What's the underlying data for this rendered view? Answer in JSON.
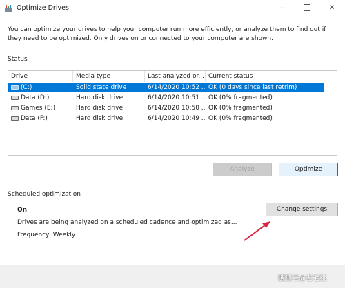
{
  "window": {
    "title": "Optimize Drives",
    "minimize_glyph": "—",
    "close_glyph": "✕"
  },
  "intro_text": "You can optimize your drives to help your computer run more efficiently, or analyze them to find out if they need to be optimized. Only drives on or connected to your computer are shown.",
  "status": {
    "label": "Status",
    "columns": [
      "Drive",
      "Media type",
      "Last analyzed or...",
      "Current status"
    ],
    "drives": [
      {
        "drive": "(C:)",
        "media_type": "Solid state drive",
        "last_analyzed": "6/14/2020 10:52 ...",
        "current_status": "OK (0 days since last retrim)",
        "selected": true
      },
      {
        "drive": "Data (D:)",
        "media_type": "Hard disk drive",
        "last_analyzed": "6/14/2020 10:51 ...",
        "current_status": "OK (0% fragmented)",
        "selected": false
      },
      {
        "drive": "Games (E:)",
        "media_type": "Hard disk drive",
        "last_analyzed": "6/14/2020 10:50 ...",
        "current_status": "OK (0% fragmented)",
        "selected": false
      },
      {
        "drive": "Data (F:)",
        "media_type": "Hard disk drive",
        "last_analyzed": "6/14/2020 10:49 ...",
        "current_status": "OK (0% fragmented)",
        "selected": false
      }
    ]
  },
  "buttons": {
    "analyze": "Analyze",
    "optimize": "Optimize",
    "change_settings": "Change settings"
  },
  "scheduled": {
    "label": "Scheduled optimization",
    "state": "On",
    "description": "Drives are being analyzed on a scheduled cadence and optimized as...",
    "frequency": "Frequency: Weekly"
  },
  "watermark": "搜狐号@老毛桃",
  "colors": {
    "selection": "#0078d7",
    "annotation_arrow": "#d7263d"
  }
}
